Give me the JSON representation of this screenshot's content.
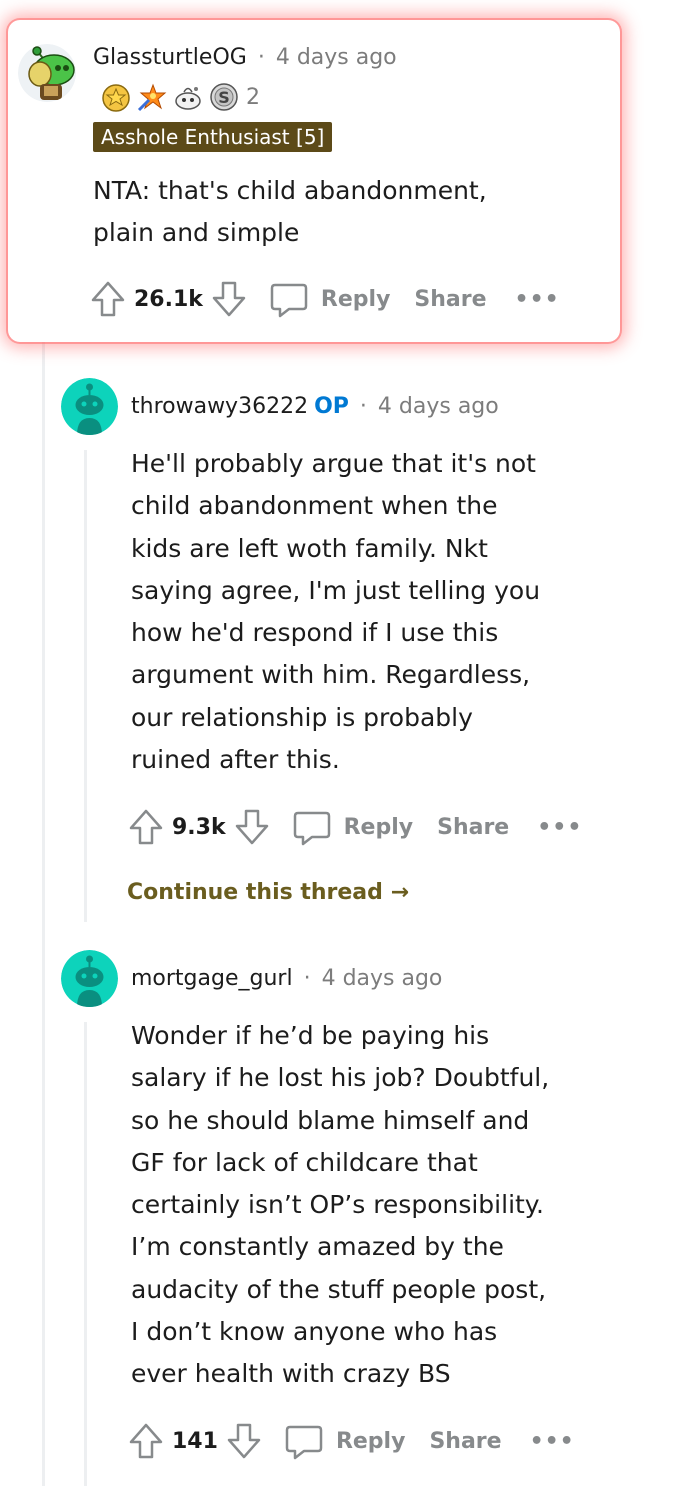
{
  "comments": [
    {
      "username": "GlassturtleOG",
      "separator": "·",
      "time": "4 days ago",
      "award_count": "2",
      "flair": "Asshole Enthusiast [5]",
      "body_lines": [
        "NTA: that's child abandonment,",
        "plain and simple"
      ],
      "score": "26.1k",
      "reply_label": "Reply",
      "share_label": "Share",
      "more_label": "•••"
    },
    {
      "username": "throwawy36222",
      "op_badge": "OP",
      "separator": "·",
      "time": "4 days ago",
      "body_lines": [
        "He'll probably argue that it's not",
        "child abandonment when the",
        "kids are left woth family. Nkt",
        "saying agree, I'm just telling you",
        "how he'd respond if I use this",
        "argument with him. Regardless,",
        "our relationship is probably",
        "ruined after this."
      ],
      "score": "9.3k",
      "reply_label": "Reply",
      "share_label": "Share",
      "more_label": "•••",
      "continue_label": "Continue this thread",
      "continue_arrow": "→"
    },
    {
      "username": "mortgage_gurl",
      "separator": "·",
      "time": "4 days ago",
      "body_lines": [
        "Wonder if he’d be paying his",
        "salary if he lost his job? Doubtful,",
        "so he should blame himself and",
        "GF for lack of childcare that",
        "certainly isn’t OP’s responsibility.",
        "I’m constantly amazed by the",
        "audacity of the stuff people post,",
        "I don’t know anyone who has",
        "ever health with crazy BS"
      ],
      "score": "141",
      "reply_label": "Reply",
      "share_label": "Share",
      "more_label": "•••"
    }
  ],
  "colors": {
    "op_badge": "#0079d3",
    "flair_bg": "#5c4a18",
    "continue_link": "#6a5d1f",
    "avatar_teal": "#0dd3bb",
    "highlight_glow": "#ff6b6b"
  },
  "icons": [
    "snoo-avatar-icon",
    "award-icon",
    "upvote-icon",
    "downvote-icon",
    "comment-reply-icon",
    "more-icon",
    "arrow-right-icon"
  ]
}
